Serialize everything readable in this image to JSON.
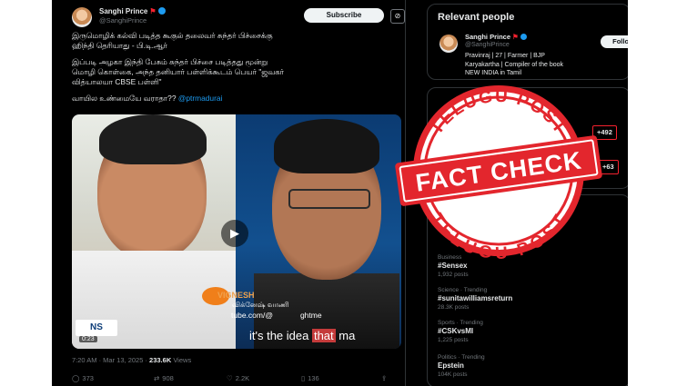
{
  "post": {
    "author_name": "Sanghi Prince",
    "author_handle": "@SanghiPrince",
    "subscribe_label": "Subscribe",
    "text_lines": [
      "இருமொழிக் கல்வி படித்த கூகுல் தலைவர் சுந்தர் பிச்சைக்கு",
      "ஹிந்தி தெரியாது - பி.டி.ஆர்"
    ],
    "text_para2": [
      "இப்படி அழகா இந்தி பேசும் சுந்தர் பிச்சை படித்தது மூன்று",
      "மொழி கொள்கை, அந்த தனியார் பள்ளிக்கூடம் பெயர் \"ஜவகர்",
      "வித்யாலயா CBSE பள்ளி\""
    ],
    "text_para3_prefix": "வாயில உண்மையே வராதா?? ",
    "mention": "@ptrmadurai",
    "video": {
      "watermark_name": "VIGNESH",
      "watermark_tamil": "விக்னேஷ் வாணி",
      "watermark_url": "tube.com/@",
      "watermark_url_tail": "ghtme",
      "caption_prefix": "it's the idea ",
      "caption_highlight": "that",
      "caption_suffix": " ma",
      "channel_logo": "NS",
      "duration": "0:23",
      "play_icon": "play-icon"
    },
    "meta_time": "7:20 AM · Mar 13, 2025 · ",
    "meta_views": "233.6K",
    "meta_views_label": " Views",
    "actions": {
      "replies": "373",
      "reposts": "908",
      "likes": "2.2K",
      "bookmarks": "136"
    }
  },
  "sidebar": {
    "relevant_title": "Relevant people",
    "person_name": "Sanghi Prince",
    "person_handle": "@SanghiPrince",
    "follow_label": "Follow",
    "bio_lines": [
      "Pravinraj | 27 | Farmer | BJP",
      "Karyakartha | Compiler of the book",
      "NEW INDIA in Tamil"
    ],
    "pill_1": "+492",
    "pill_2": "+63",
    "trends": [
      {
        "meta": "Business",
        "name": "#Sensex",
        "count": "1,932 posts"
      },
      {
        "meta": "Science · Trending",
        "name": "#sunitawilliamsreturn",
        "count": "28.3K posts"
      },
      {
        "meta": "Sports · Trending",
        "name": "#CSKvsMI",
        "count": "1,225 posts"
      },
      {
        "meta": "Politics · Trending",
        "name": "Epstein",
        "count": "104K posts"
      }
    ]
  },
  "stamp": {
    "top_text": "TELUGU POST",
    "main_text": "FACT CHECK",
    "bottom_text": "TELUGU POST",
    "color": "#e3262d"
  }
}
